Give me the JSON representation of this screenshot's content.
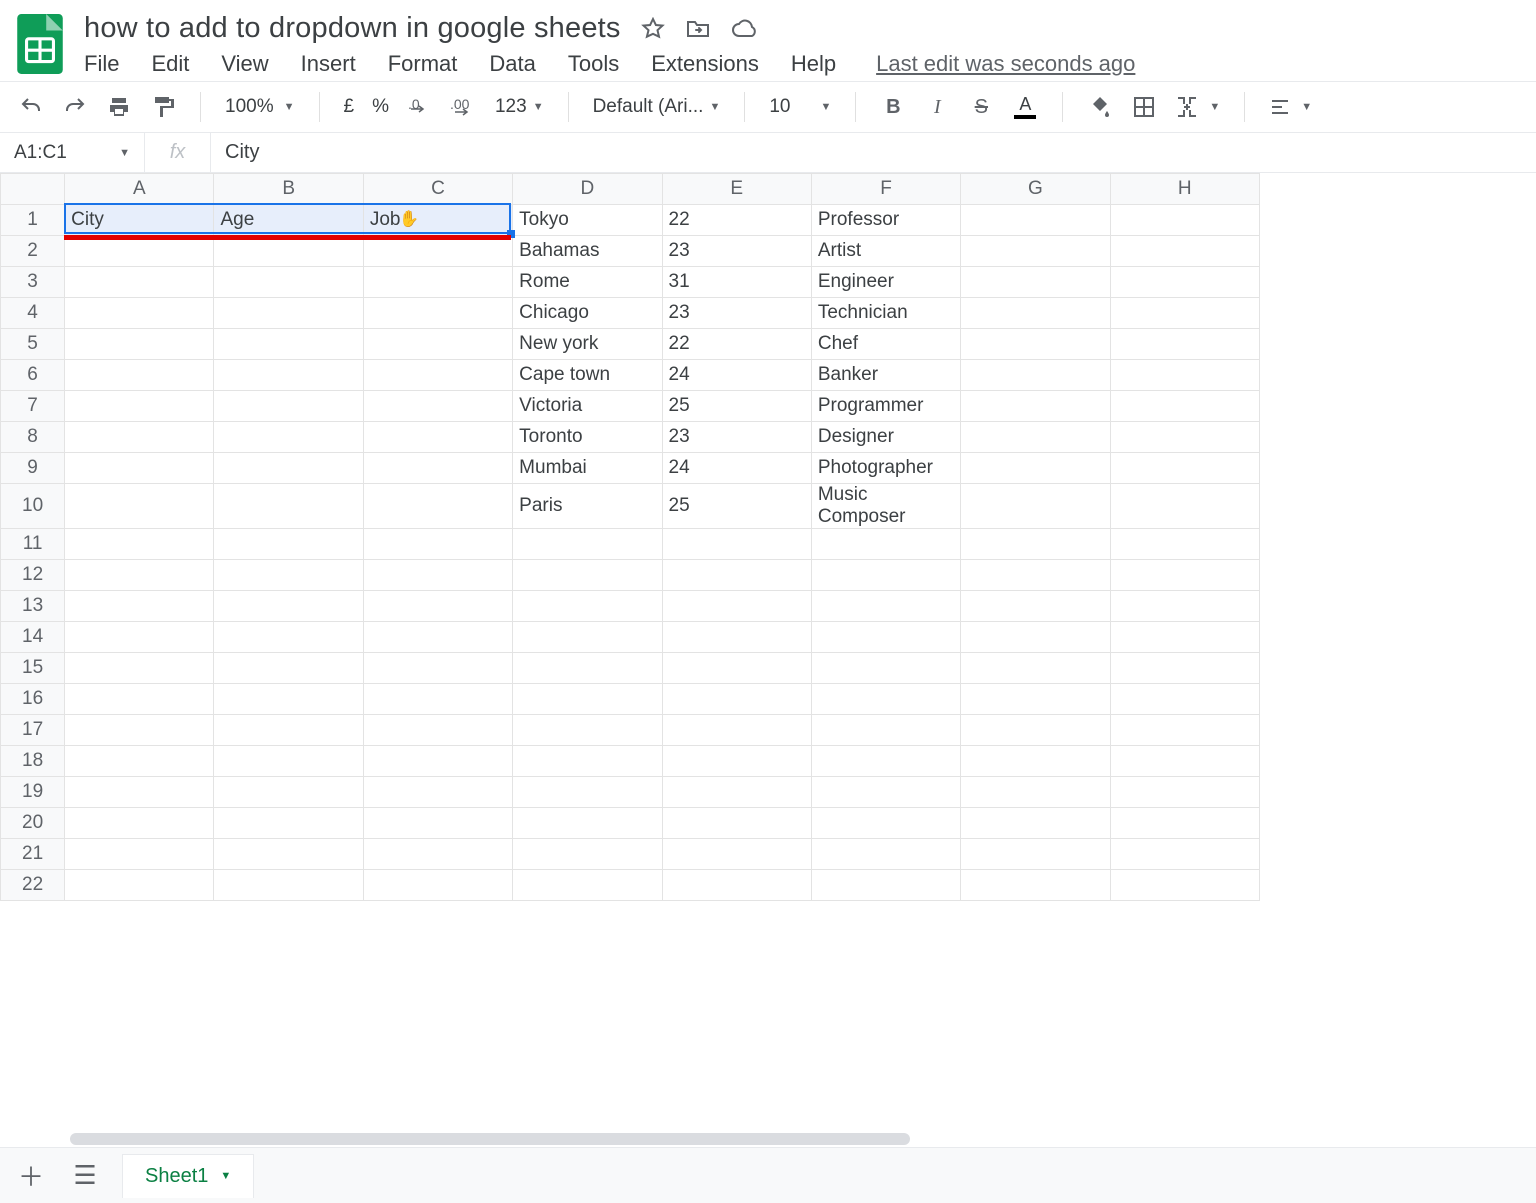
{
  "doc": {
    "title": "how to add to dropdown in google sheets",
    "last_edit": "Last edit was seconds ago"
  },
  "menus": [
    "File",
    "Edit",
    "View",
    "Insert",
    "Format",
    "Data",
    "Tools",
    "Extensions",
    "Help"
  ],
  "toolbar": {
    "zoom": "100%",
    "currency": "£",
    "percent": "%",
    "dec_dec": ".0",
    "dec_inc": ".00",
    "more_formats": "123",
    "font": "Default (Ari...",
    "font_size": "10"
  },
  "name_box": "A1:C1",
  "fx_value": "City",
  "columns": [
    "A",
    "B",
    "C",
    "D",
    "E",
    "F",
    "G",
    "H"
  ],
  "row_count": 22,
  "cells": {
    "A1": "City",
    "B1": "Age",
    "C1": "Job",
    "D1": "Tokyo",
    "E1": "22",
    "F1": "Professor",
    "D2": "Bahamas",
    "E2": "23",
    "F2": "Artist",
    "D3": "Rome",
    "E3": "31",
    "F3": "Engineer",
    "D4": "Chicago",
    "E4": "23",
    "F4": "Technician",
    "D5": "New york",
    "E5": "22",
    "F5": "Chef",
    "D6": "Cape town",
    "E6": "24",
    "F6": "Banker",
    "D7": "Victoria",
    "E7": "25",
    "F7": "Programmer",
    "D8": "Toronto",
    "E8": "23",
    "F8": "Designer",
    "D9": "Mumbai",
    "E9": "24",
    "F9": "Photographer",
    "D10": "Paris",
    "E10": "25",
    "F10": "Music Composer"
  },
  "tabs": {
    "sheet1": "Sheet1"
  }
}
